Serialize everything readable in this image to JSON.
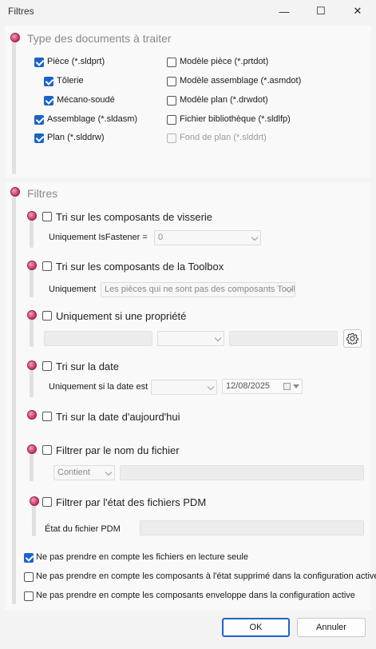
{
  "window": {
    "title": "Filtres",
    "minimize_glyph": "—",
    "maximize_glyph": "☐",
    "close_glyph": "✕"
  },
  "doc_types": {
    "title": "Type des documents à traiter",
    "items_left": [
      {
        "label": "Pièce (*.sldprt)",
        "checked": true
      },
      {
        "label": "Tôlerie",
        "checked": true
      },
      {
        "label": "Mécano-soudé",
        "checked": true
      },
      {
        "label": "Assemblage  (*.sldasm)",
        "checked": true
      },
      {
        "label": "Plan  (*.slddrw)",
        "checked": true
      }
    ],
    "items_right": [
      {
        "label": "Modèle pièce (*.prtdot)",
        "checked": false
      },
      {
        "label": "Modèle assemblage  (*.asmdot)",
        "checked": false
      },
      {
        "label": "Modèle plan  (*.drwdot)",
        "checked": false
      },
      {
        "label": "Fichier bibliothèque  (*.sldlfp)",
        "checked": false
      },
      {
        "label": "Fond de plan  (*.slddrt)",
        "checked": false,
        "disabled": true
      }
    ]
  },
  "filters": {
    "title": "Filtres",
    "visserie": {
      "label": "Tri sur les composants de visserie",
      "sub_label": "Uniquement IsFastener =",
      "value": "0"
    },
    "toolbox": {
      "label": "Tri sur les composants de la Toolbox",
      "sub_label": "Uniquement",
      "value": "Les pièces qui ne sont pas des composants Toolbox"
    },
    "property": {
      "label": "Uniquement si une propriété"
    },
    "date": {
      "label": "Tri sur la date",
      "sub_label": "Uniquement si la date est",
      "date_value": "12/08/2025"
    },
    "today": {
      "label": "Tri sur la date d'aujourd'hui"
    },
    "filename": {
      "label": "Filtrer par le nom du fichier",
      "mode": "Contient"
    },
    "pdm": {
      "label": "Filtrer par l'état des fichiers PDM",
      "sub_label": "État du fichier PDM"
    }
  },
  "options": [
    {
      "label": "Ne pas prendre en compte les fichiers en lecture seule",
      "checked": true
    },
    {
      "label": "Ne pas prendre en compte les composants à l'état supprimé dans la configuration active",
      "checked": false
    },
    {
      "label": "Ne pas prendre en compte les composants enveloppe dans la configuration active",
      "checked": false
    }
  ],
  "buttons": {
    "ok": "OK",
    "cancel": "Annuler"
  },
  "colors": {
    "accent": "#1a64c8",
    "bullet": "#c2315c"
  }
}
